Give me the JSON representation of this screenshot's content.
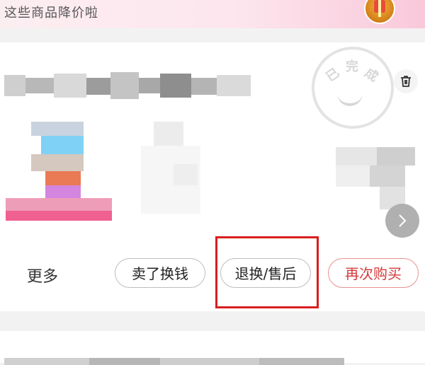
{
  "banner": {
    "text": "这些商品降价啦",
    "gift_icon": "gift-box-icon"
  },
  "order": {
    "status_stamp": [
      "已",
      "完",
      "成"
    ],
    "delete_icon": "trash-icon",
    "next_icon": "chevron-right-icon"
  },
  "actions": {
    "more": "更多",
    "sell": "卖了换钱",
    "return": "退换/售后",
    "rebuy": "再次购买"
  },
  "colors": {
    "accent": "#d63a3a",
    "highlight": "#d81e1e"
  }
}
